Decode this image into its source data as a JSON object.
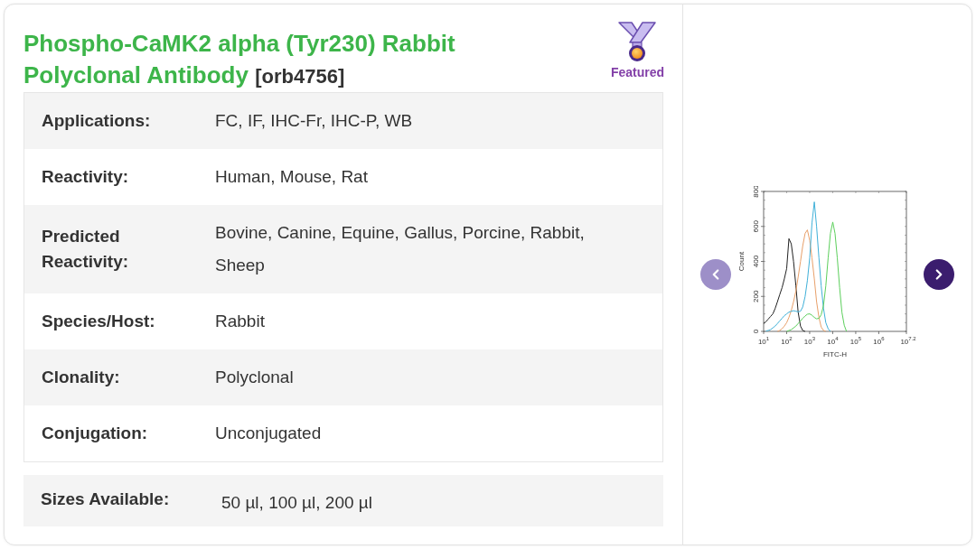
{
  "product": {
    "title": "Phospho-CaMK2 alpha (Tyr230) Rabbit Polyclonal Antibody",
    "catalog_number": "[orb4756]",
    "badge": "Featured"
  },
  "specs": [
    {
      "label": "Applications:",
      "value": "FC, IF, IHC-Fr, IHC-P, WB"
    },
    {
      "label": "Reactivity:",
      "value": "Human, Mouse, Rat"
    },
    {
      "label": "Predicted Reactivity:",
      "value": "Bovine, Canine, Equine, Gallus, Porcine, Rabbit, Sheep"
    },
    {
      "label": "Species/Host:",
      "value": "Rabbit"
    },
    {
      "label": "Clonality:",
      "value": "Polyclonal"
    },
    {
      "label": "Conjugation:",
      "value": "Unconjugated"
    }
  ],
  "sizes": {
    "label": "Sizes Available:",
    "value": "50 µl, 100 µl, 200 µl"
  },
  "gallery": {
    "prev_button": {
      "disabled": true
    },
    "next_button": {
      "disabled": false
    },
    "chart_data": {
      "type": "line",
      "xlabel": "FITC-H",
      "ylabel": "Count",
      "ylim": [
        0,
        800
      ],
      "yticks": [
        0,
        200,
        400,
        600,
        800
      ],
      "categories": [
        "10$^{1}$",
        null,
        null,
        null,
        null,
        null,
        null,
        null,
        null,
        null,
        "10$^{2}$",
        null,
        null,
        null,
        null,
        null,
        null,
        null,
        null,
        null,
        "10$^{3}$",
        null,
        null,
        null,
        null,
        null,
        null,
        null,
        null,
        null,
        "10$^{4}$",
        null,
        null,
        null,
        null,
        null,
        null,
        null,
        null,
        null,
        "10$^{5}$",
        null,
        null,
        null,
        null,
        null,
        null,
        null,
        null,
        null,
        "10$^{6}$",
        null,
        null,
        null,
        null,
        null,
        null,
        null,
        null,
        null,
        null,
        null,
        "10$^{7.2}$"
      ],
      "series": [
        {
          "color": "#222222",
          "values": [
            45,
            55,
            70,
            85,
            100,
            130,
            170,
            210,
            250,
            300,
            360,
            530,
            500,
            400,
            260,
            110,
            30,
            5,
            0,
            null,
            null,
            null,
            null,
            null,
            null,
            null,
            null,
            null,
            null,
            null,
            null,
            null,
            null,
            null,
            null,
            null,
            null,
            null,
            null,
            null,
            null,
            null,
            null,
            null,
            null,
            null,
            null,
            null,
            null,
            null,
            null,
            null,
            null,
            null,
            null,
            null,
            null,
            null,
            null,
            null,
            null,
            null,
            null
          ]
        },
        {
          "color": "#e8a06a",
          "values": [
            null,
            null,
            null,
            null,
            null,
            null,
            0,
            5,
            15,
            30,
            50,
            80,
            120,
            170,
            230,
            310,
            400,
            490,
            560,
            580,
            520,
            420,
            300,
            170,
            80,
            25,
            5,
            0,
            null,
            null,
            null,
            null,
            null,
            null,
            null,
            null,
            null,
            null,
            null,
            null,
            null,
            null,
            null,
            null,
            null,
            null,
            null,
            null,
            null,
            null,
            null,
            null,
            null,
            null,
            null,
            null,
            null,
            null,
            null,
            null,
            null,
            null,
            null
          ]
        },
        {
          "color": "#3fb0d8",
          "values": [
            null,
            2,
            5,
            10,
            20,
            30,
            45,
            60,
            75,
            90,
            100,
            110,
            115,
            118,
            115,
            112,
            115,
            140,
            200,
            290,
            420,
            620,
            740,
            600,
            420,
            260,
            130,
            50,
            15,
            0,
            null,
            null,
            null,
            null,
            null,
            null,
            null,
            null,
            null,
            null,
            null,
            null,
            null,
            null,
            null,
            null,
            null,
            null,
            null,
            null,
            null,
            null,
            null,
            null,
            null,
            null,
            null,
            null,
            null,
            null,
            null,
            null,
            null
          ]
        },
        {
          "color": "#5ccf5c",
          "values": [
            null,
            null,
            null,
            null,
            null,
            null,
            null,
            null,
            null,
            null,
            0,
            5,
            10,
            20,
            30,
            45,
            60,
            75,
            88,
            98,
            100,
            92,
            80,
            72,
            75,
            95,
            150,
            260,
            420,
            560,
            625,
            560,
            420,
            250,
            110,
            35,
            0,
            null,
            null,
            null,
            null,
            null,
            null,
            null,
            null,
            null,
            null,
            null,
            null,
            null,
            null,
            null,
            null,
            null,
            null,
            null,
            null,
            null,
            null,
            null,
            null,
            null,
            null
          ]
        }
      ]
    }
  }
}
